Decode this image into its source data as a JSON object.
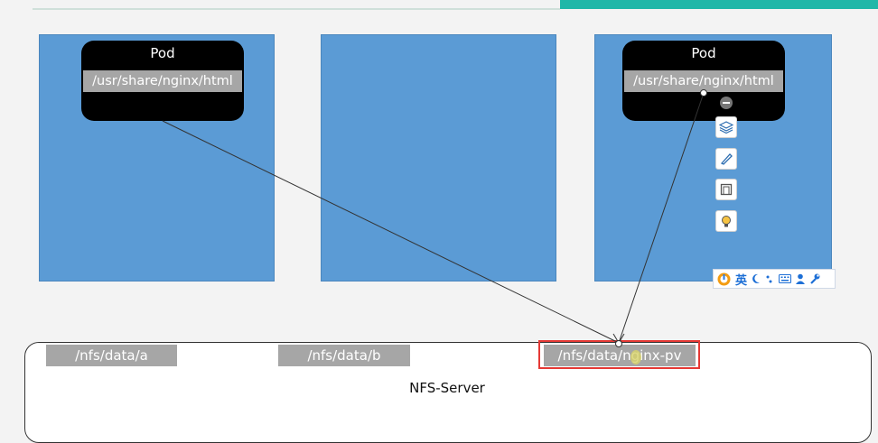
{
  "pods": [
    {
      "title": "Pod",
      "mount_path": "/usr/share/nginx/html"
    },
    {
      "title": "Pod",
      "mount_path": "/usr/share/nginx/html"
    }
  ],
  "nfs_server": {
    "label": "NFS-Server",
    "shares": [
      "/nfs/data/a",
      "/nfs/data/b",
      "/nfs/data/nginx-pv"
    ]
  },
  "ime_toolbar": {
    "language": "英",
    "icons": [
      "ime-logo-icon",
      "moon-icon",
      "punctuation-icon",
      "keyboard-icon",
      "user-icon",
      "wrench-icon"
    ]
  },
  "side_tools": [
    "minus-circle-icon",
    "layers-icon",
    "pen-icon",
    "frame-icon",
    "lightbulb-icon"
  ],
  "colors": {
    "node": "#5b9bd5",
    "pod": "#000000",
    "path_bar": "#a6a6a6",
    "highlight": "#e53935",
    "accent": "#1fb7a8"
  }
}
